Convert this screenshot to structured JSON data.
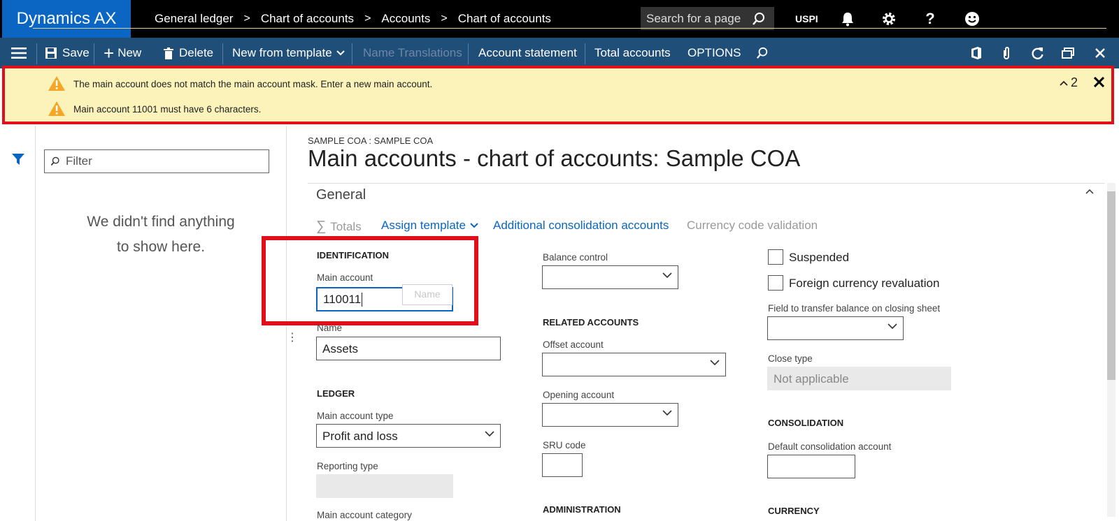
{
  "app": {
    "name": "Dynamics AX"
  },
  "breadcrumb": [
    "General ledger",
    "Chart of accounts",
    "Accounts",
    "Chart of accounts"
  ],
  "search": {
    "placeholder": "Search for a page"
  },
  "company": "USPI",
  "actions": {
    "save": "Save",
    "new": "New",
    "delete": "Delete",
    "new_from_template": "New from template",
    "name_translations": "Name Translations",
    "account_statement": "Account statement",
    "total_accounts": "Total accounts",
    "options": "OPTIONS"
  },
  "messages": {
    "items": [
      "The main account does not match the main account mask. Enter a new main account.",
      "Main account 11001 must have 6 characters."
    ],
    "count": "2"
  },
  "filter": {
    "placeholder": "Filter",
    "empty_line1": "We didn't find anything",
    "empty_line2": "to show here."
  },
  "page": {
    "context": "SAMPLE COA : SAMPLE COA",
    "title": "Main accounts - chart of accounts: Sample COA"
  },
  "fasttab": {
    "title": "General",
    "links": {
      "totals": "Totals",
      "assign_template": "Assign template",
      "additional_consolidation": "Additional consolidation accounts",
      "currency_validation": "Currency code validation"
    }
  },
  "form": {
    "identification": "IDENTIFICATION",
    "main_account_label": "Main account",
    "main_account_value": "110011",
    "name_overlay": "Name",
    "name_label": "Name",
    "name_value": "Assets",
    "ledger": "LEDGER",
    "main_account_type_label": "Main account type",
    "main_account_type_value": "Profit and loss",
    "reporting_type_label": "Reporting type",
    "main_account_category_label": "Main account category",
    "balance_control_label": "Balance control",
    "related_accounts": "RELATED ACCOUNTS",
    "offset_account_label": "Offset account",
    "opening_account_label": "Opening account",
    "sru_code_label": "SRU code",
    "administration": "ADMINISTRATION",
    "suspended_label": "Suspended",
    "foreign_currency_label": "Foreign currency revaluation",
    "transfer_field_label": "Field to transfer balance on closing sheet",
    "close_type_label": "Close type",
    "close_type_value": "Not applicable",
    "consolidation": "CONSOLIDATION",
    "default_consolidation_label": "Default consolidation account",
    "currency": "CURRENCY"
  },
  "colors": {
    "brand": "#0a66c2",
    "action_pane": "#1f4e79",
    "warning_bg": "#fbf3b9",
    "highlight": "#e0101a"
  }
}
